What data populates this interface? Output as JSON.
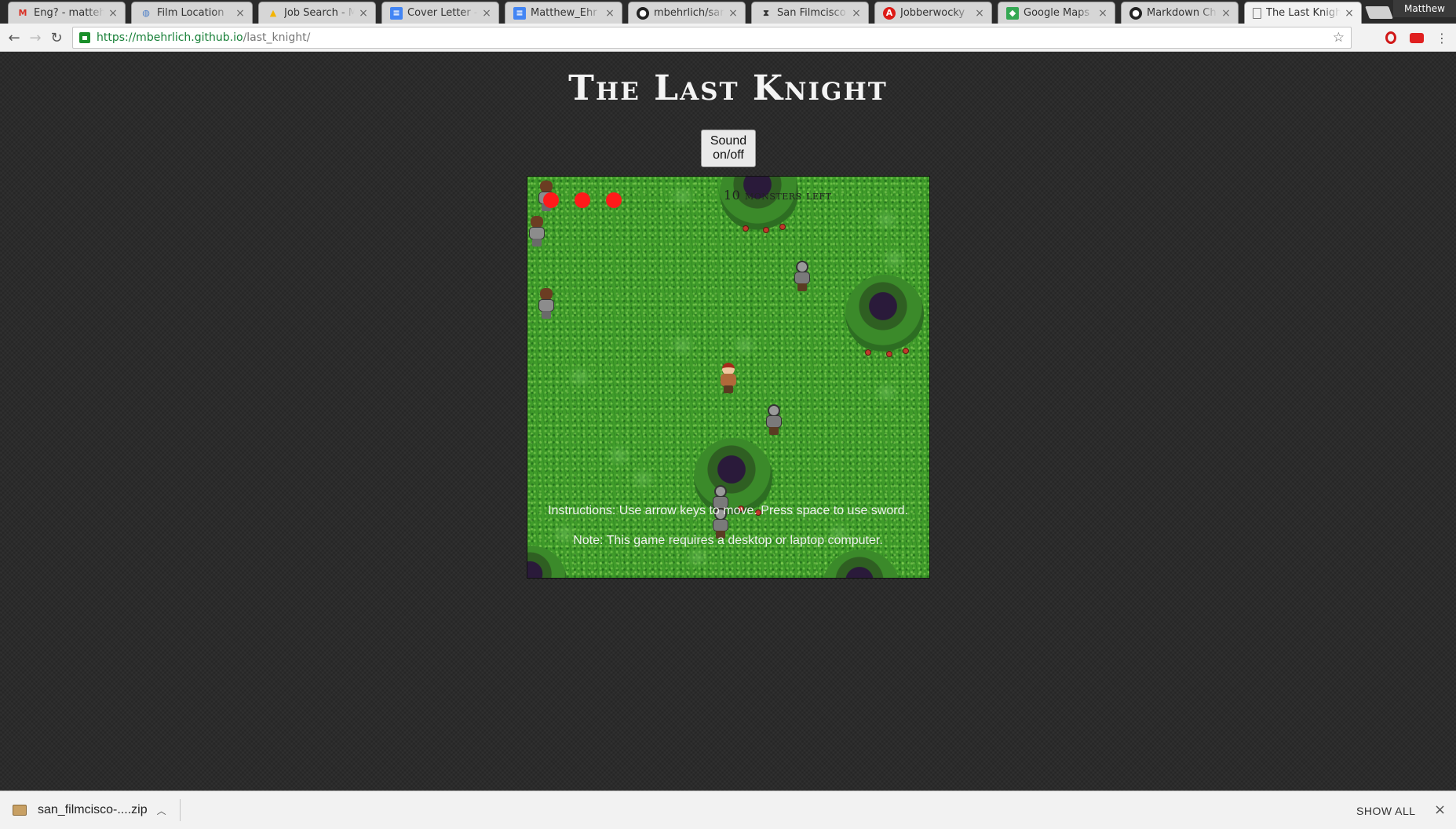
{
  "browser": {
    "tabs": [
      {
        "title": "Eng? - matteh",
        "icon": "gmail-icon",
        "active": false
      },
      {
        "title": "Film Location",
        "icon": "globe-icon",
        "active": false
      },
      {
        "title": "Job Search - M",
        "icon": "drive-icon",
        "active": false
      },
      {
        "title": "Cover Letter -",
        "icon": "docs-icon",
        "active": false
      },
      {
        "title": "Matthew_Ehr",
        "icon": "docs-icon",
        "active": false
      },
      {
        "title": "mbehrlich/sar",
        "icon": "github-icon",
        "active": false
      },
      {
        "title": "San Filmcisco",
        "icon": "hourglass-icon",
        "active": false
      },
      {
        "title": "Jobberwocky",
        "icon": "angular-icon",
        "active": false
      },
      {
        "title": "Google Maps",
        "icon": "maps-icon",
        "active": false
      },
      {
        "title": "Markdown Ch",
        "icon": "github-icon",
        "active": false
      },
      {
        "title": "The Last Knigh",
        "icon": "page-icon",
        "active": true
      }
    ],
    "profile_name": "Matthew",
    "url_host": "https://mbehrlich.github.io",
    "url_path": "/last_knight/"
  },
  "page": {
    "title": "The Last Knight",
    "sound_button_label": "Sound on/off",
    "instructions": "Instructions: Use arrow keys to move. Press space to use sword.",
    "note": "Note: This game requires a desktop or laptop computer."
  },
  "game": {
    "hud_text": "10 monsters left",
    "lives": 3,
    "life_color": "#ff1a1a",
    "grass_color": "#3f9b2a"
  },
  "download_shelf": {
    "file_name": "san_filmcisco-....zip",
    "show_all_label": "SHOW ALL"
  }
}
